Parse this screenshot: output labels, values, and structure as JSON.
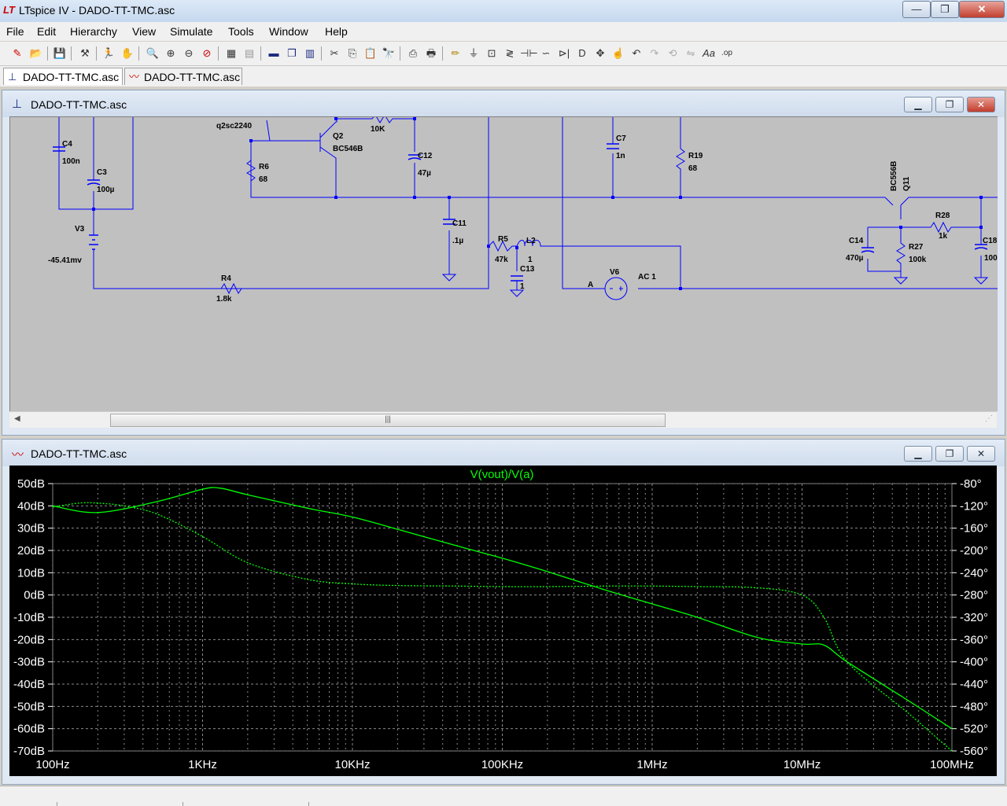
{
  "window": {
    "title": "LTspice IV - DADO-TT-TMC.asc",
    "logo": "LT",
    "minimize_label": "—",
    "maximize_label": "❐",
    "close_label": "✕"
  },
  "menu": [
    "File",
    "Edit",
    "Hierarchy",
    "View",
    "Simulate",
    "Tools",
    "Window",
    "Help"
  ],
  "tabs": [
    {
      "label": "DADO-TT-TMC.asc",
      "icon": "schematic-icon"
    },
    {
      "label": "DADO-TT-TMC.asc",
      "icon": "waveform-icon"
    }
  ],
  "schematic_window": {
    "title": "DADO-TT-TMC.asc"
  },
  "plot_window": {
    "title": "DADO-TT-TMC.asc"
  },
  "schematic": {
    "labels": {
      "q2model": "q2sc2240",
      "q2": "Q2",
      "q2val": "BC546B",
      "r_top": "10K",
      "c4": "C4",
      "c4v": "100n",
      "c3": "C3",
      "c3v": "100µ",
      "v3": "V3",
      "v3v": "-45.41mv",
      "r6": "R6",
      "r6v": "68",
      "c12": "C12",
      "c12v": "47µ",
      "c11": "C11",
      "c11v": ".1µ",
      "r5": "R5",
      "r5v": "47k",
      "l2": "L2",
      "l2v": "1",
      "c13": "C13",
      "c13v": "1",
      "r4": "R4",
      "r4v": "1.8k",
      "c7": "C7",
      "c7v": "1n",
      "r19": "R19",
      "r19v": "68",
      "v6": "V6",
      "v6a": "A",
      "v6v": "AC 1",
      "q11": "Q11",
      "q11v": "BC556B",
      "r28": "R28",
      "r28v": "1k",
      "c14": "C14",
      "c14v": "470µ",
      "r27": "R27",
      "r27v": "100k",
      "c18": "C18",
      "c18v": "100"
    }
  },
  "chart_data": {
    "type": "line",
    "title": "V(vout)/V(a)",
    "x_scale": "log",
    "xlim": [
      100,
      100000000
    ],
    "x_ticks": [
      "100Hz",
      "1KHz",
      "10KHz",
      "100KHz",
      "1MHz",
      "10MHz",
      "100MHz"
    ],
    "ylim_left": [
      -70,
      50
    ],
    "y_left_ticks": [
      "50dB",
      "40dB",
      "30dB",
      "20dB",
      "10dB",
      "0dB",
      "-10dB",
      "-20dB",
      "-30dB",
      "-40dB",
      "-50dB",
      "-60dB",
      "-70dB"
    ],
    "ylim_right": [
      -560,
      -80
    ],
    "y_right_ticks": [
      "-80°",
      "-120°",
      "-160°",
      "-200°",
      "-240°",
      "-280°",
      "-320°",
      "-360°",
      "-400°",
      "-440°",
      "-480°",
      "-520°",
      "-560°"
    ],
    "grid": true,
    "color": "#00ff00",
    "series": [
      {
        "name": "magnitude",
        "style": "solid",
        "axis": "left",
        "x": [
          100,
          200,
          500,
          1000,
          1300,
          2000,
          5000,
          10000,
          20000,
          50000,
          100000,
          200000,
          500000,
          1000000,
          2000000,
          5000000,
          10000000,
          14000000,
          20000000,
          50000000,
          100000000
        ],
        "y": [
          40,
          37,
          42,
          47.5,
          48,
          45,
          39,
          35,
          29.5,
          22,
          16.5,
          10.5,
          2,
          -4,
          -10,
          -19,
          -22,
          -22.5,
          -30,
          -47,
          -60
        ]
      },
      {
        "name": "phase",
        "style": "dashed",
        "axis": "right",
        "x": [
          100,
          150,
          200,
          300,
          500,
          1000,
          2000,
          5000,
          10000,
          20000,
          50000,
          100000,
          200000,
          500000,
          1000000,
          2000000,
          5000000,
          10000000,
          14000000,
          20000000,
          50000000,
          100000000
        ],
        "y": [
          -122,
          -115,
          -115,
          -120,
          -135,
          -175,
          -222,
          -252,
          -260,
          -263,
          -264,
          -265,
          -265,
          -264,
          -264,
          -265,
          -267,
          -280,
          -320,
          -400,
          -490,
          -560
        ]
      }
    ]
  }
}
